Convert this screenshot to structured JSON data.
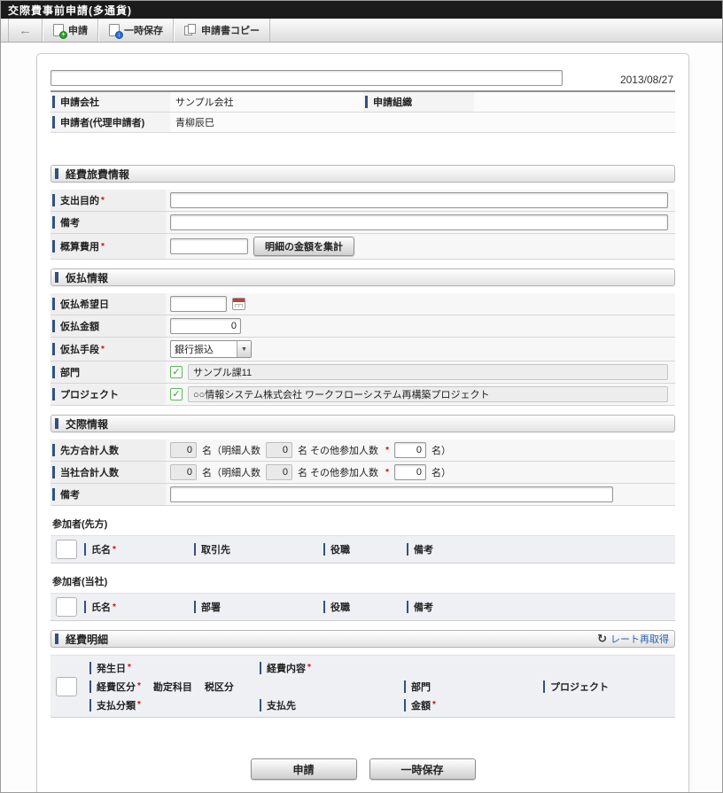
{
  "window_title": "交際費事前申請(多通貨)",
  "icons": {
    "back": "←",
    "refresh": "↻",
    "check": "✓",
    "dropdown": "▼",
    "required": "*",
    "doc_plus": "+",
    "doc_save": "↓"
  },
  "toolbar": {
    "apply": "申請",
    "temp_save": "一時保存",
    "copy": "申請書コピー"
  },
  "header": {
    "date": "2013/08/27",
    "subject_value": "",
    "company_label": "申請会社",
    "company_value": "サンプル会社",
    "org_label": "申請組織",
    "org_value": "",
    "applicant_label": "申請者(代理申請者)",
    "applicant_value": "青柳辰巳"
  },
  "expense_info": {
    "title": "経費旅費情報",
    "purpose_label": "支出目的",
    "note_label": "備考",
    "estimate_label": "概算費用",
    "estimate_value": "",
    "sum_button": "明細の金額を集計"
  },
  "advance_info": {
    "title": "仮払情報",
    "date_label": "仮払希望日",
    "date_value": "",
    "amount_label": "仮払金額",
    "amount_value": "0",
    "method_label": "仮払手段",
    "method_value": "銀行振込",
    "dept_label": "部門",
    "dept_value": "サンプル課11",
    "project_label": "プロジェクト",
    "project_value": "○○情報システム株式会社 ワークフローシステム再構築プロジェクト"
  },
  "social_info": {
    "title": "交際情報",
    "rows": [
      {
        "label": "先方合計人数"
      },
      {
        "label": "当社合計人数"
      }
    ],
    "count_value": "0",
    "piece1": "名（明細人数",
    "piece2": "名 その他参加人数",
    "piece3": "名）",
    "note_label": "備考",
    "note_value": ""
  },
  "participants": {
    "guest_title": "参加者(先方)",
    "guest_columns": [
      {
        "label": "氏名"
      },
      {
        "label": "取引先"
      },
      {
        "label": "役職"
      },
      {
        "label": "備考"
      }
    ],
    "company_title": "参加者(当社)",
    "company_columns": [
      {
        "label": "氏名"
      },
      {
        "label": "部署"
      },
      {
        "label": "役職"
      },
      {
        "label": "備考"
      }
    ]
  },
  "detail": {
    "title": "経費明細",
    "rate_refresh": "レート再取得",
    "occur_date": "発生日",
    "content": "経費内容",
    "category": "経費区分",
    "account": "勘定科目",
    "tax": "税区分",
    "dept": "部門",
    "project": "プロジェクト",
    "pay_class": "支払分類",
    "payee": "支払先",
    "amount": "金額"
  },
  "footer": {
    "apply": "申請",
    "temp_save": "一時保存"
  }
}
